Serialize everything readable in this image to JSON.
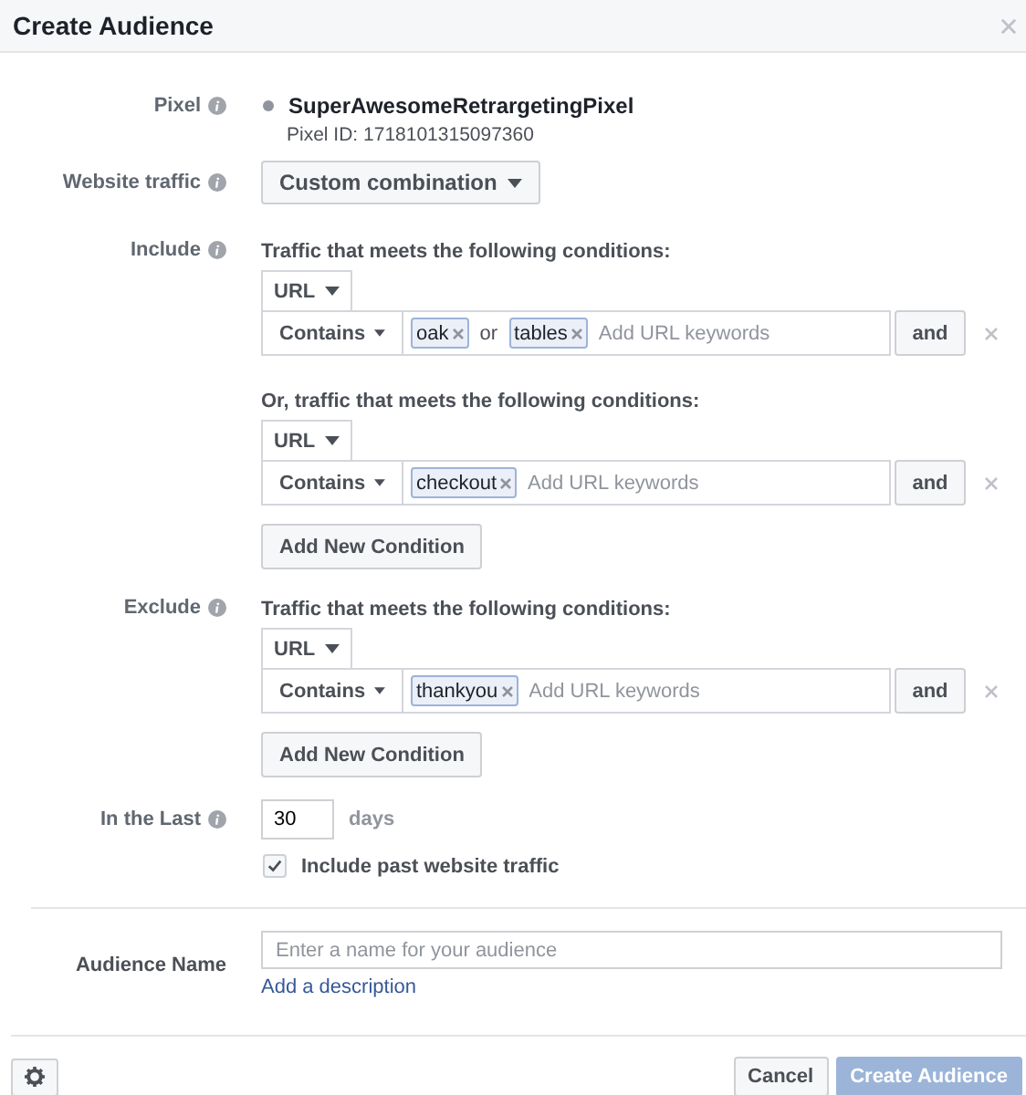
{
  "dialog": {
    "title": "Create Audience"
  },
  "pixel": {
    "label": "Pixel",
    "name": "SuperAwesomeRetrargetingPixel",
    "id_text": "Pixel ID: 1718101315097360"
  },
  "website_traffic": {
    "label": "Website traffic",
    "value": "Custom combination"
  },
  "include": {
    "label": "Include",
    "groups": [
      {
        "heading": "Traffic that meets the following conditions:",
        "field": "URL",
        "operator": "Contains",
        "keywords": [
          "oak",
          "tables"
        ],
        "separator": "or",
        "placeholder": "Add URL keywords",
        "and_button": "and"
      },
      {
        "heading": "Or, traffic that meets the following conditions:",
        "field": "URL",
        "operator": "Contains",
        "keywords": [
          "checkout"
        ],
        "placeholder": "Add URL keywords",
        "and_button": "and"
      }
    ],
    "add_button": "Add New Condition"
  },
  "exclude": {
    "label": "Exclude",
    "groups": [
      {
        "heading": "Traffic that meets the following conditions:",
        "field": "URL",
        "operator": "Contains",
        "keywords": [
          "thankyou"
        ],
        "placeholder": "Add URL keywords",
        "and_button": "and"
      }
    ],
    "add_button": "Add New Condition"
  },
  "in_the_last": {
    "label": "In the Last",
    "value": "30",
    "unit": "days"
  },
  "past_traffic": {
    "label": "Include past website traffic",
    "checked": true
  },
  "audience_name": {
    "label": "Audience Name",
    "placeholder": "Enter a name for your audience",
    "link": "Add a description"
  },
  "footer": {
    "cancel": "Cancel",
    "create": "Create Audience",
    "create_disabled": true
  }
}
